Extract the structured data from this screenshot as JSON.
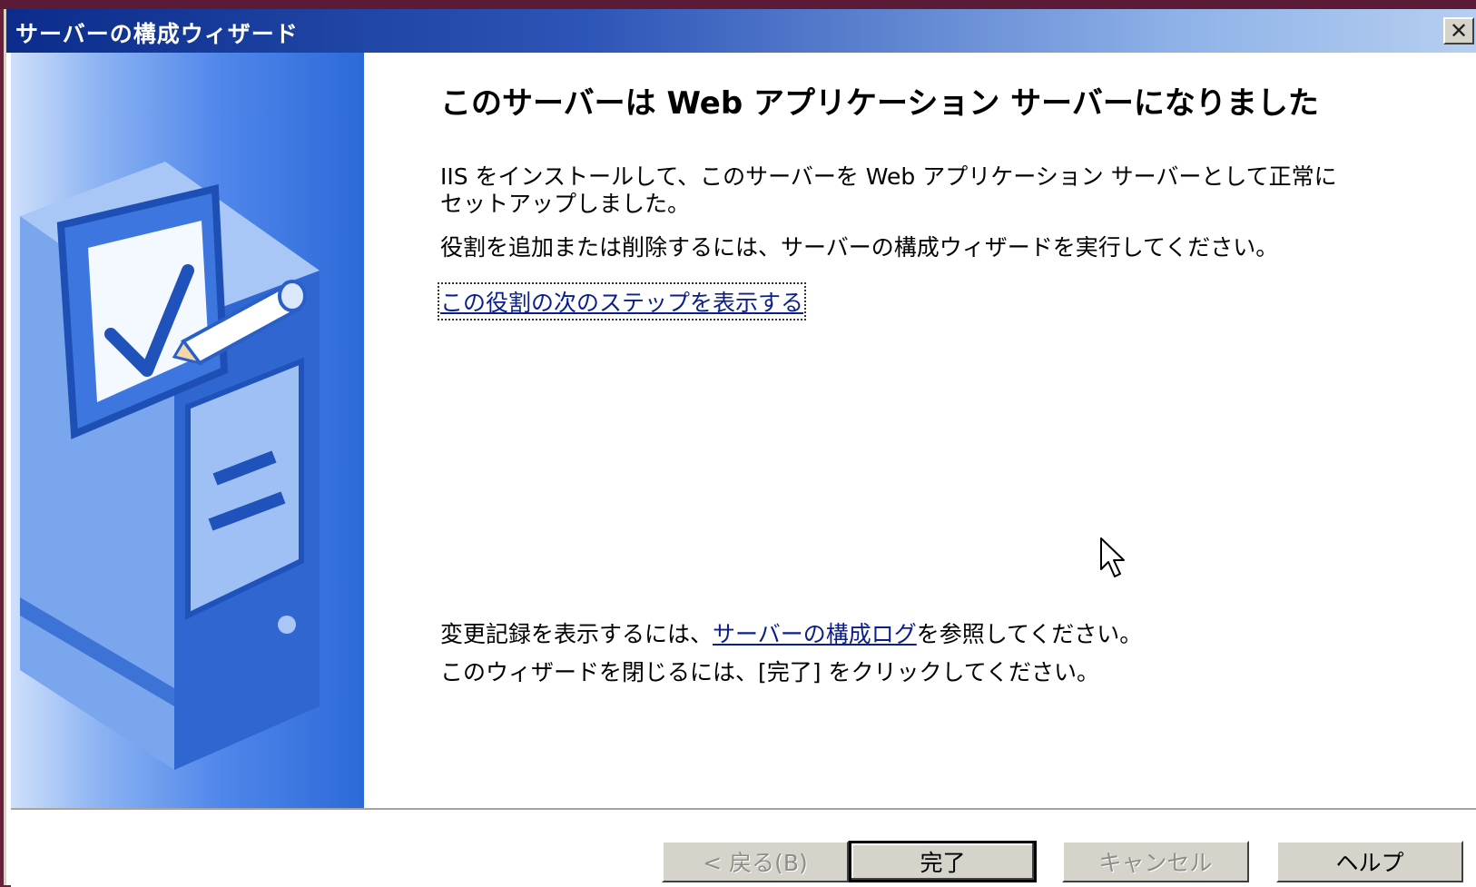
{
  "window": {
    "title": "サーバーの構成ウィザード",
    "close_label": "✕"
  },
  "content": {
    "heading": "このサーバーは Web アプリケーション サーバーになりました",
    "paragraph1": "IIS をインストールして、このサーバーを Web アプリケーション サーバーとして正常にセットアップしました。",
    "paragraph2": "役割を追加または削除するには、サーバーの構成ウィザードを実行してください。",
    "next_steps_link": "この役割の次のステップを表示する",
    "log_prefix": "変更記録を表示するには、",
    "log_link": "サーバーの構成ログ",
    "log_suffix": "を参照してください。",
    "close_instruction": "このウィザードを閉じるには、[完了] をクリックしてください。"
  },
  "buttons": {
    "back": "< 戻る(B)",
    "finish": "完了",
    "cancel": "キャンセル",
    "help": "ヘルプ"
  },
  "colors": {
    "title_gradient_start": "#0b2c8a",
    "title_gradient_end": "#b6cff1",
    "link": "#0b1f8c",
    "side_panel": "#2c6ad8"
  },
  "icons": {
    "close": "close-icon",
    "wizard_art": "checklist-server-illustration",
    "cursor": "mouse-pointer-icon"
  }
}
